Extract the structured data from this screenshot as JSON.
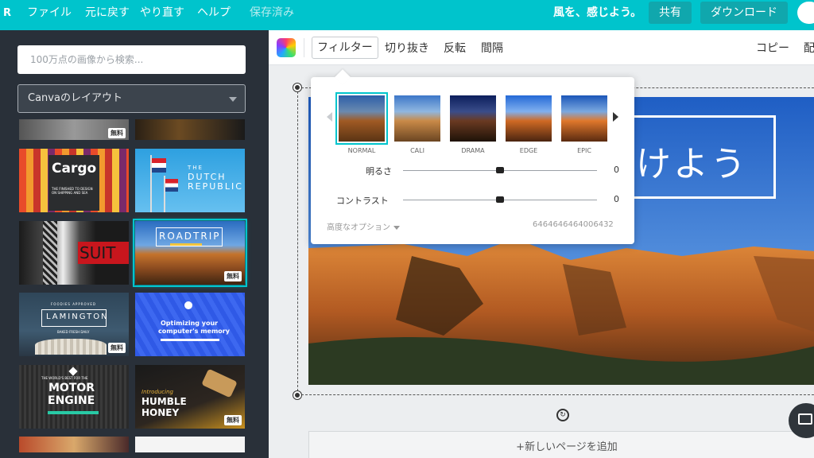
{
  "topbar": {
    "logo": "R",
    "menu": [
      "ファイル",
      "元に戻す",
      "やり直す",
      "ヘルプ",
      "保存済み"
    ],
    "slogan": "風を、感じよう。",
    "share_label": "共有",
    "download_label": "ダウンロード"
  },
  "sidebar": {
    "search_placeholder": "100万点の画像から検索...",
    "layout_select": "Canvaのレイアウト",
    "badge_free": "無料",
    "thumbnails": {
      "cargo": {
        "title": "Cargo",
        "subtitle": "THE FINISHED TO DESIGN ON SHIPPING AND SEA"
      },
      "dutch": {
        "title1": "THE",
        "title2": "DUTCH",
        "title3": "REPUBLIC"
      },
      "suit": {
        "title": "SUIT"
      },
      "roadtrip": {
        "title": "ROADTRIP"
      },
      "lamington": {
        "kicker": "FOODIES APPROVED",
        "title": "LAMINGTON",
        "sub": "BAKED FRESH DAILY"
      },
      "memory": {
        "title1": "Optimizing your",
        "title2": "computer's memory"
      },
      "motor": {
        "kicker": "THE WORLD'S BEST FOR THE",
        "title1": "MOTOR",
        "title2": "ENGINE"
      },
      "honey": {
        "kicker": "Introducing",
        "title1": "HUMBLE",
        "title2": "HONEY"
      }
    }
  },
  "toolbar": {
    "filter": "フィルター",
    "crop": "切り抜き",
    "flip": "反転",
    "spacing": "間隔",
    "copy": "コピー",
    "arrange": "配"
  },
  "filter_panel": {
    "filters": [
      "NORMAL",
      "CALI",
      "DRAMA",
      "EDGE",
      "EPIC"
    ],
    "selected": "NORMAL",
    "brightness_label": "明るさ",
    "brightness_value": "0",
    "brightness_level": 0.5,
    "contrast_label": "コントラスト",
    "contrast_value": "0",
    "contrast_level": 0.5,
    "advanced_label": "高度なオプション",
    "code": "6464646464006432"
  },
  "canvas": {
    "headline": "けよう",
    "add_page": "+新しいページを追加"
  },
  "colors": {
    "accent": "#00c4cc",
    "sidebar_bg": "#293039"
  }
}
